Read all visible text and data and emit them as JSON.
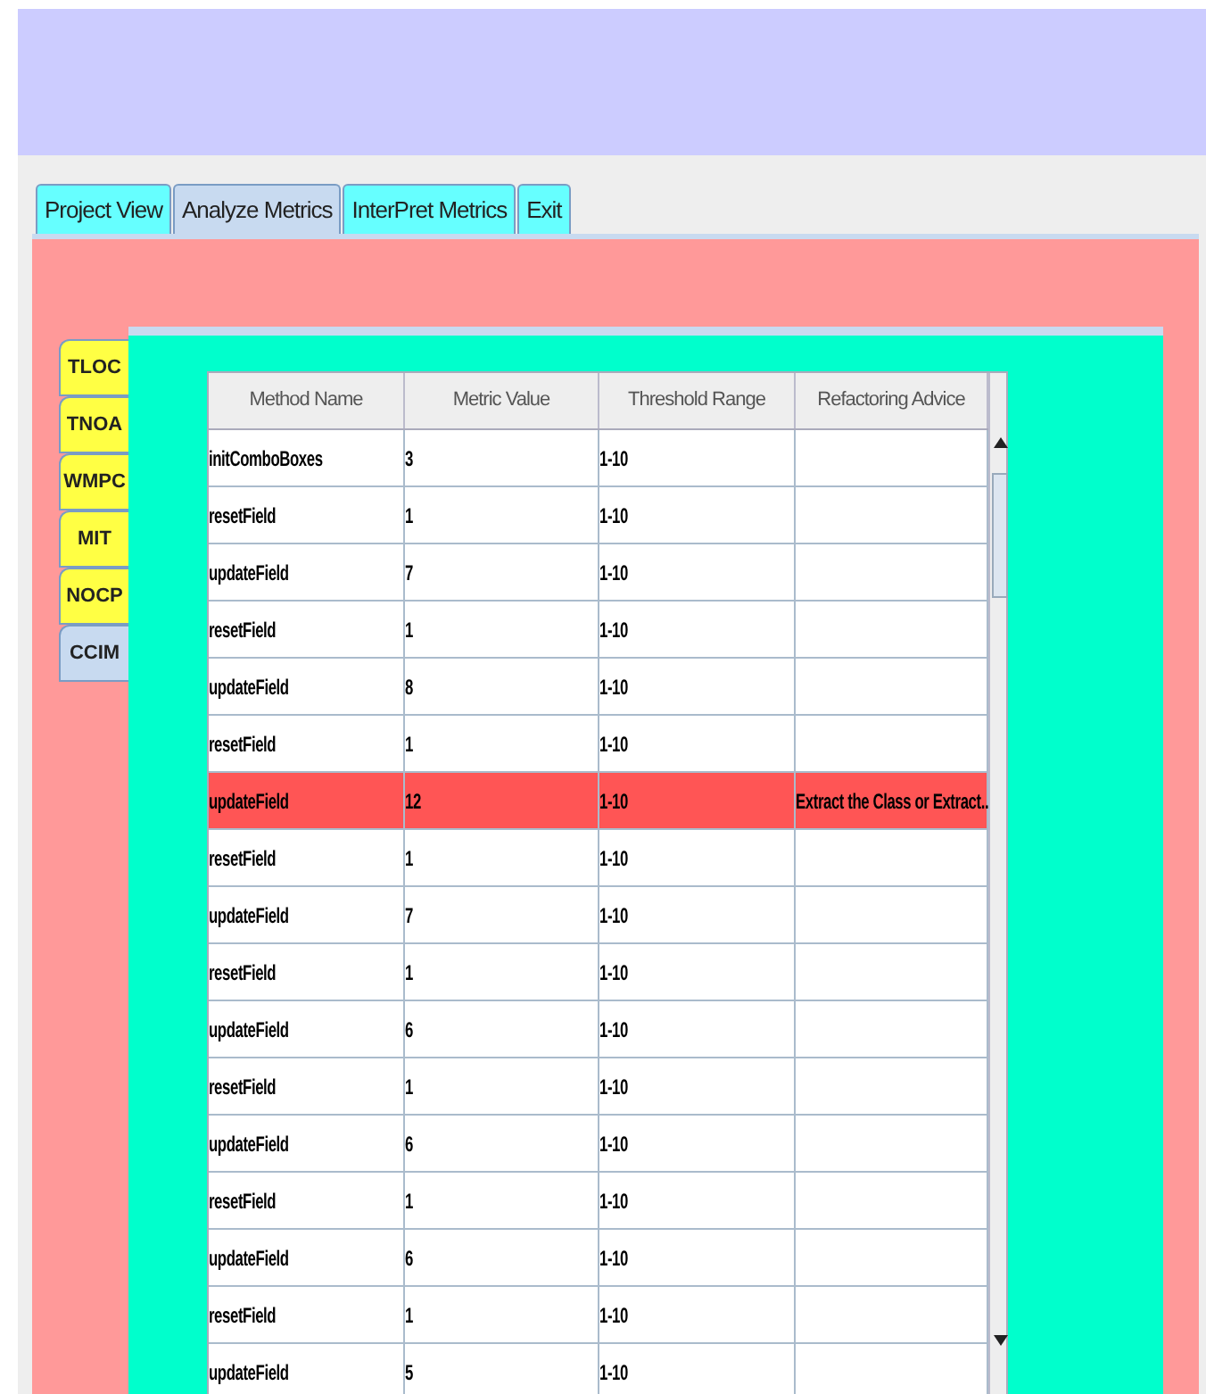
{
  "tabs": [
    {
      "label": "Project View",
      "selected": false
    },
    {
      "label": "Analyze Metrics",
      "selected": true
    },
    {
      "label": "InterPret Metrics",
      "selected": false
    },
    {
      "label": "Exit",
      "selected": false
    }
  ],
  "metric_tabs": [
    {
      "label": "TLOC",
      "selected": false
    },
    {
      "label": "TNOA",
      "selected": false
    },
    {
      "label": "WMPC",
      "selected": false
    },
    {
      "label": "MIT",
      "selected": false
    },
    {
      "label": "NOCP",
      "selected": false
    },
    {
      "label": "CCIM",
      "selected": true
    }
  ],
  "table": {
    "columns": [
      "Method Name",
      "Metric Value",
      "Threshold Range",
      "Refactoring Advice"
    ],
    "rows": [
      {
        "cells": [
          "initComboBoxes",
          "3",
          "1-10",
          ""
        ],
        "flagged": false
      },
      {
        "cells": [
          "resetField",
          "1",
          "1-10",
          ""
        ],
        "flagged": false
      },
      {
        "cells": [
          "updateField",
          "7",
          "1-10",
          ""
        ],
        "flagged": false
      },
      {
        "cells": [
          "resetField",
          "1",
          "1-10",
          ""
        ],
        "flagged": false
      },
      {
        "cells": [
          "updateField",
          "8",
          "1-10",
          ""
        ],
        "flagged": false
      },
      {
        "cells": [
          "resetField",
          "1",
          "1-10",
          ""
        ],
        "flagged": false
      },
      {
        "cells": [
          "updateField",
          "12",
          "1-10",
          "Extract the Class or Extract..."
        ],
        "flagged": true
      },
      {
        "cells": [
          "resetField",
          "1",
          "1-10",
          ""
        ],
        "flagged": false
      },
      {
        "cells": [
          "updateField",
          "7",
          "1-10",
          ""
        ],
        "flagged": false
      },
      {
        "cells": [
          "resetField",
          "1",
          "1-10",
          ""
        ],
        "flagged": false
      },
      {
        "cells": [
          "updateField",
          "6",
          "1-10",
          ""
        ],
        "flagged": false
      },
      {
        "cells": [
          "resetField",
          "1",
          "1-10",
          ""
        ],
        "flagged": false
      },
      {
        "cells": [
          "updateField",
          "6",
          "1-10",
          ""
        ],
        "flagged": false
      },
      {
        "cells": [
          "resetField",
          "1",
          "1-10",
          ""
        ],
        "flagged": false
      },
      {
        "cells": [
          "updateField",
          "6",
          "1-10",
          ""
        ],
        "flagged": false
      },
      {
        "cells": [
          "resetField",
          "1",
          "1-10",
          ""
        ],
        "flagged": false
      },
      {
        "cells": [
          "updateField",
          "5",
          "1-10",
          ""
        ],
        "flagged": false
      }
    ]
  }
}
